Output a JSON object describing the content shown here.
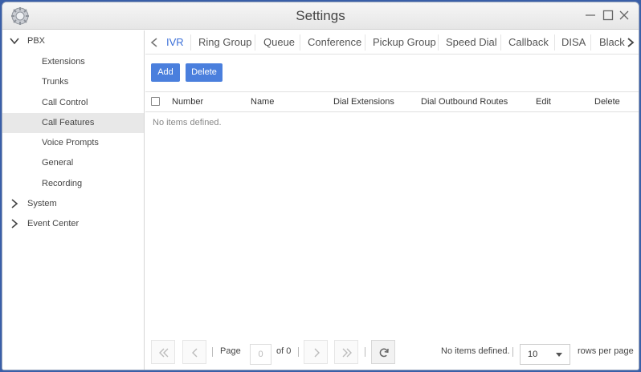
{
  "window": {
    "title": "Settings"
  },
  "sidebar": {
    "pbx": {
      "label": "PBX",
      "expanded": true
    },
    "items": [
      {
        "label": "Extensions",
        "selected": false
      },
      {
        "label": "Trunks",
        "selected": false
      },
      {
        "label": "Call Control",
        "selected": false
      },
      {
        "label": "Call Features",
        "selected": true
      },
      {
        "label": "Voice Prompts",
        "selected": false
      },
      {
        "label": "General",
        "selected": false
      },
      {
        "label": "Recording",
        "selected": false
      }
    ],
    "system": {
      "label": "System",
      "expanded": false
    },
    "event_center": {
      "label": "Event Center",
      "expanded": false
    }
  },
  "tabs": [
    {
      "label": "IVR",
      "active": true
    },
    {
      "label": "Ring Group",
      "active": false
    },
    {
      "label": "Queue",
      "active": false
    },
    {
      "label": "Conference",
      "active": false
    },
    {
      "label": "Pickup Group",
      "active": false
    },
    {
      "label": "Speed Dial",
      "active": false
    },
    {
      "label": "Callback",
      "active": false
    },
    {
      "label": "DISA",
      "active": false
    },
    {
      "label": "Black",
      "active": false
    }
  ],
  "toolbar": {
    "add_label": "Add",
    "delete_label": "Delete"
  },
  "table": {
    "columns": [
      "Number",
      "Name",
      "Dial Extensions",
      "Dial Outbound Routes",
      "Edit",
      "Delete"
    ],
    "rows": [],
    "empty_message": "No items defined."
  },
  "pager": {
    "page_label": "Page",
    "page_value": "0",
    "of_label": "of 0",
    "status": "No items defined.",
    "per_page_value": "10",
    "per_page_label": "rows per page"
  },
  "colors": {
    "accent": "#4a7fdd",
    "active_tab": "#3b6fd8",
    "selected_row": "#e8e8e8",
    "desktop": "#3a5fa8"
  }
}
